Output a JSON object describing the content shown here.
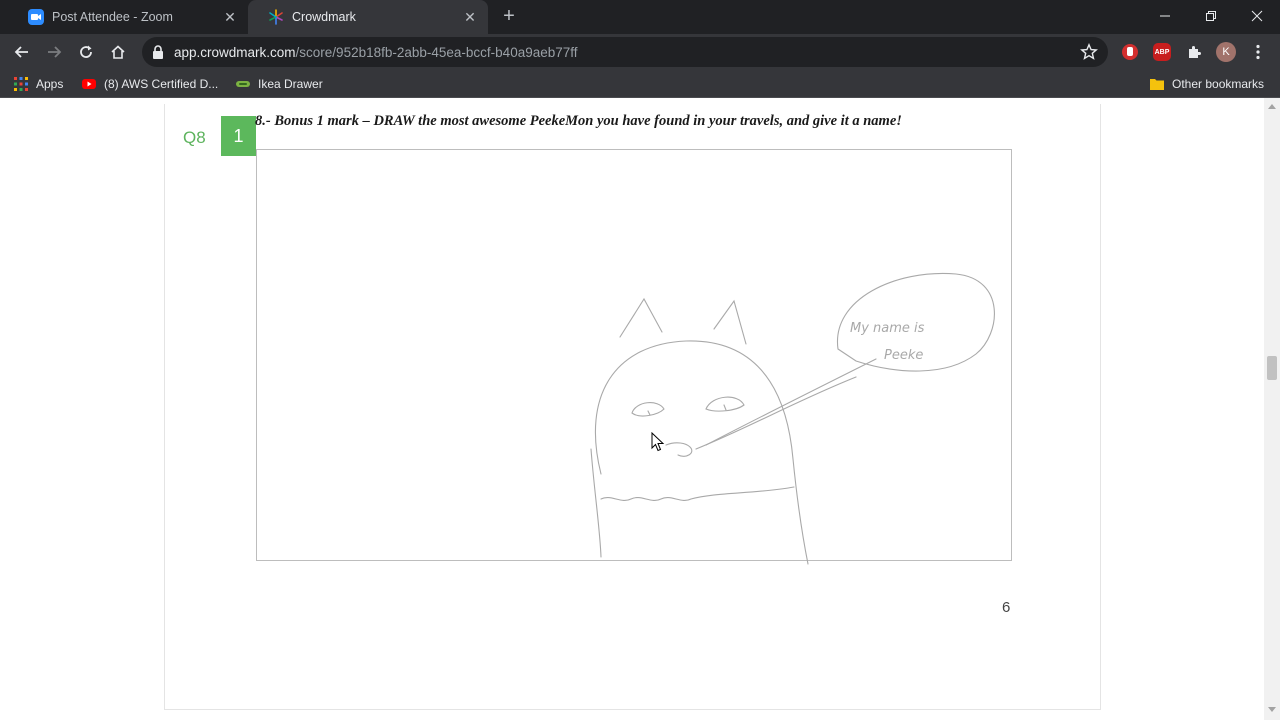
{
  "browser": {
    "tabs": [
      {
        "title": "Post Attendee - Zoom",
        "favicon": "zoom-icon",
        "active": false
      },
      {
        "title": "Crowdmark",
        "favicon": "crowdmark-icon",
        "active": true
      }
    ],
    "url": {
      "host": "app.crowdmark.com",
      "path": "/score/952b18fb-2abb-45ea-bccf-b40a9aeb77ff"
    },
    "profile_initial": "K",
    "extensions": [
      "red-hand-extension-icon",
      "adblock-plus-icon",
      "puzzle-extensions-icon"
    ],
    "abp_label": "ABP"
  },
  "bookmarks": {
    "items": [
      {
        "label": "Apps",
        "icon": "apps-grid-icon"
      },
      {
        "label": "(8) AWS Certified D...",
        "icon": "youtube-icon"
      },
      {
        "label": "Ikea Drawer",
        "icon": "link-icon"
      }
    ],
    "other": "Other bookmarks"
  },
  "question": {
    "label": "Q8",
    "score": "1",
    "text": "8.- Bonus 1 mark – DRAW the most awesome PeekeMon you have found in your travels, and give it a name!"
  },
  "drawing": {
    "speech_line1": "My name is",
    "speech_line2": "Peeke"
  },
  "page_number": "6",
  "colors": {
    "score_green": "#5cb85c",
    "chrome_dark": "#202124",
    "chrome_toolbar": "#35363a"
  }
}
